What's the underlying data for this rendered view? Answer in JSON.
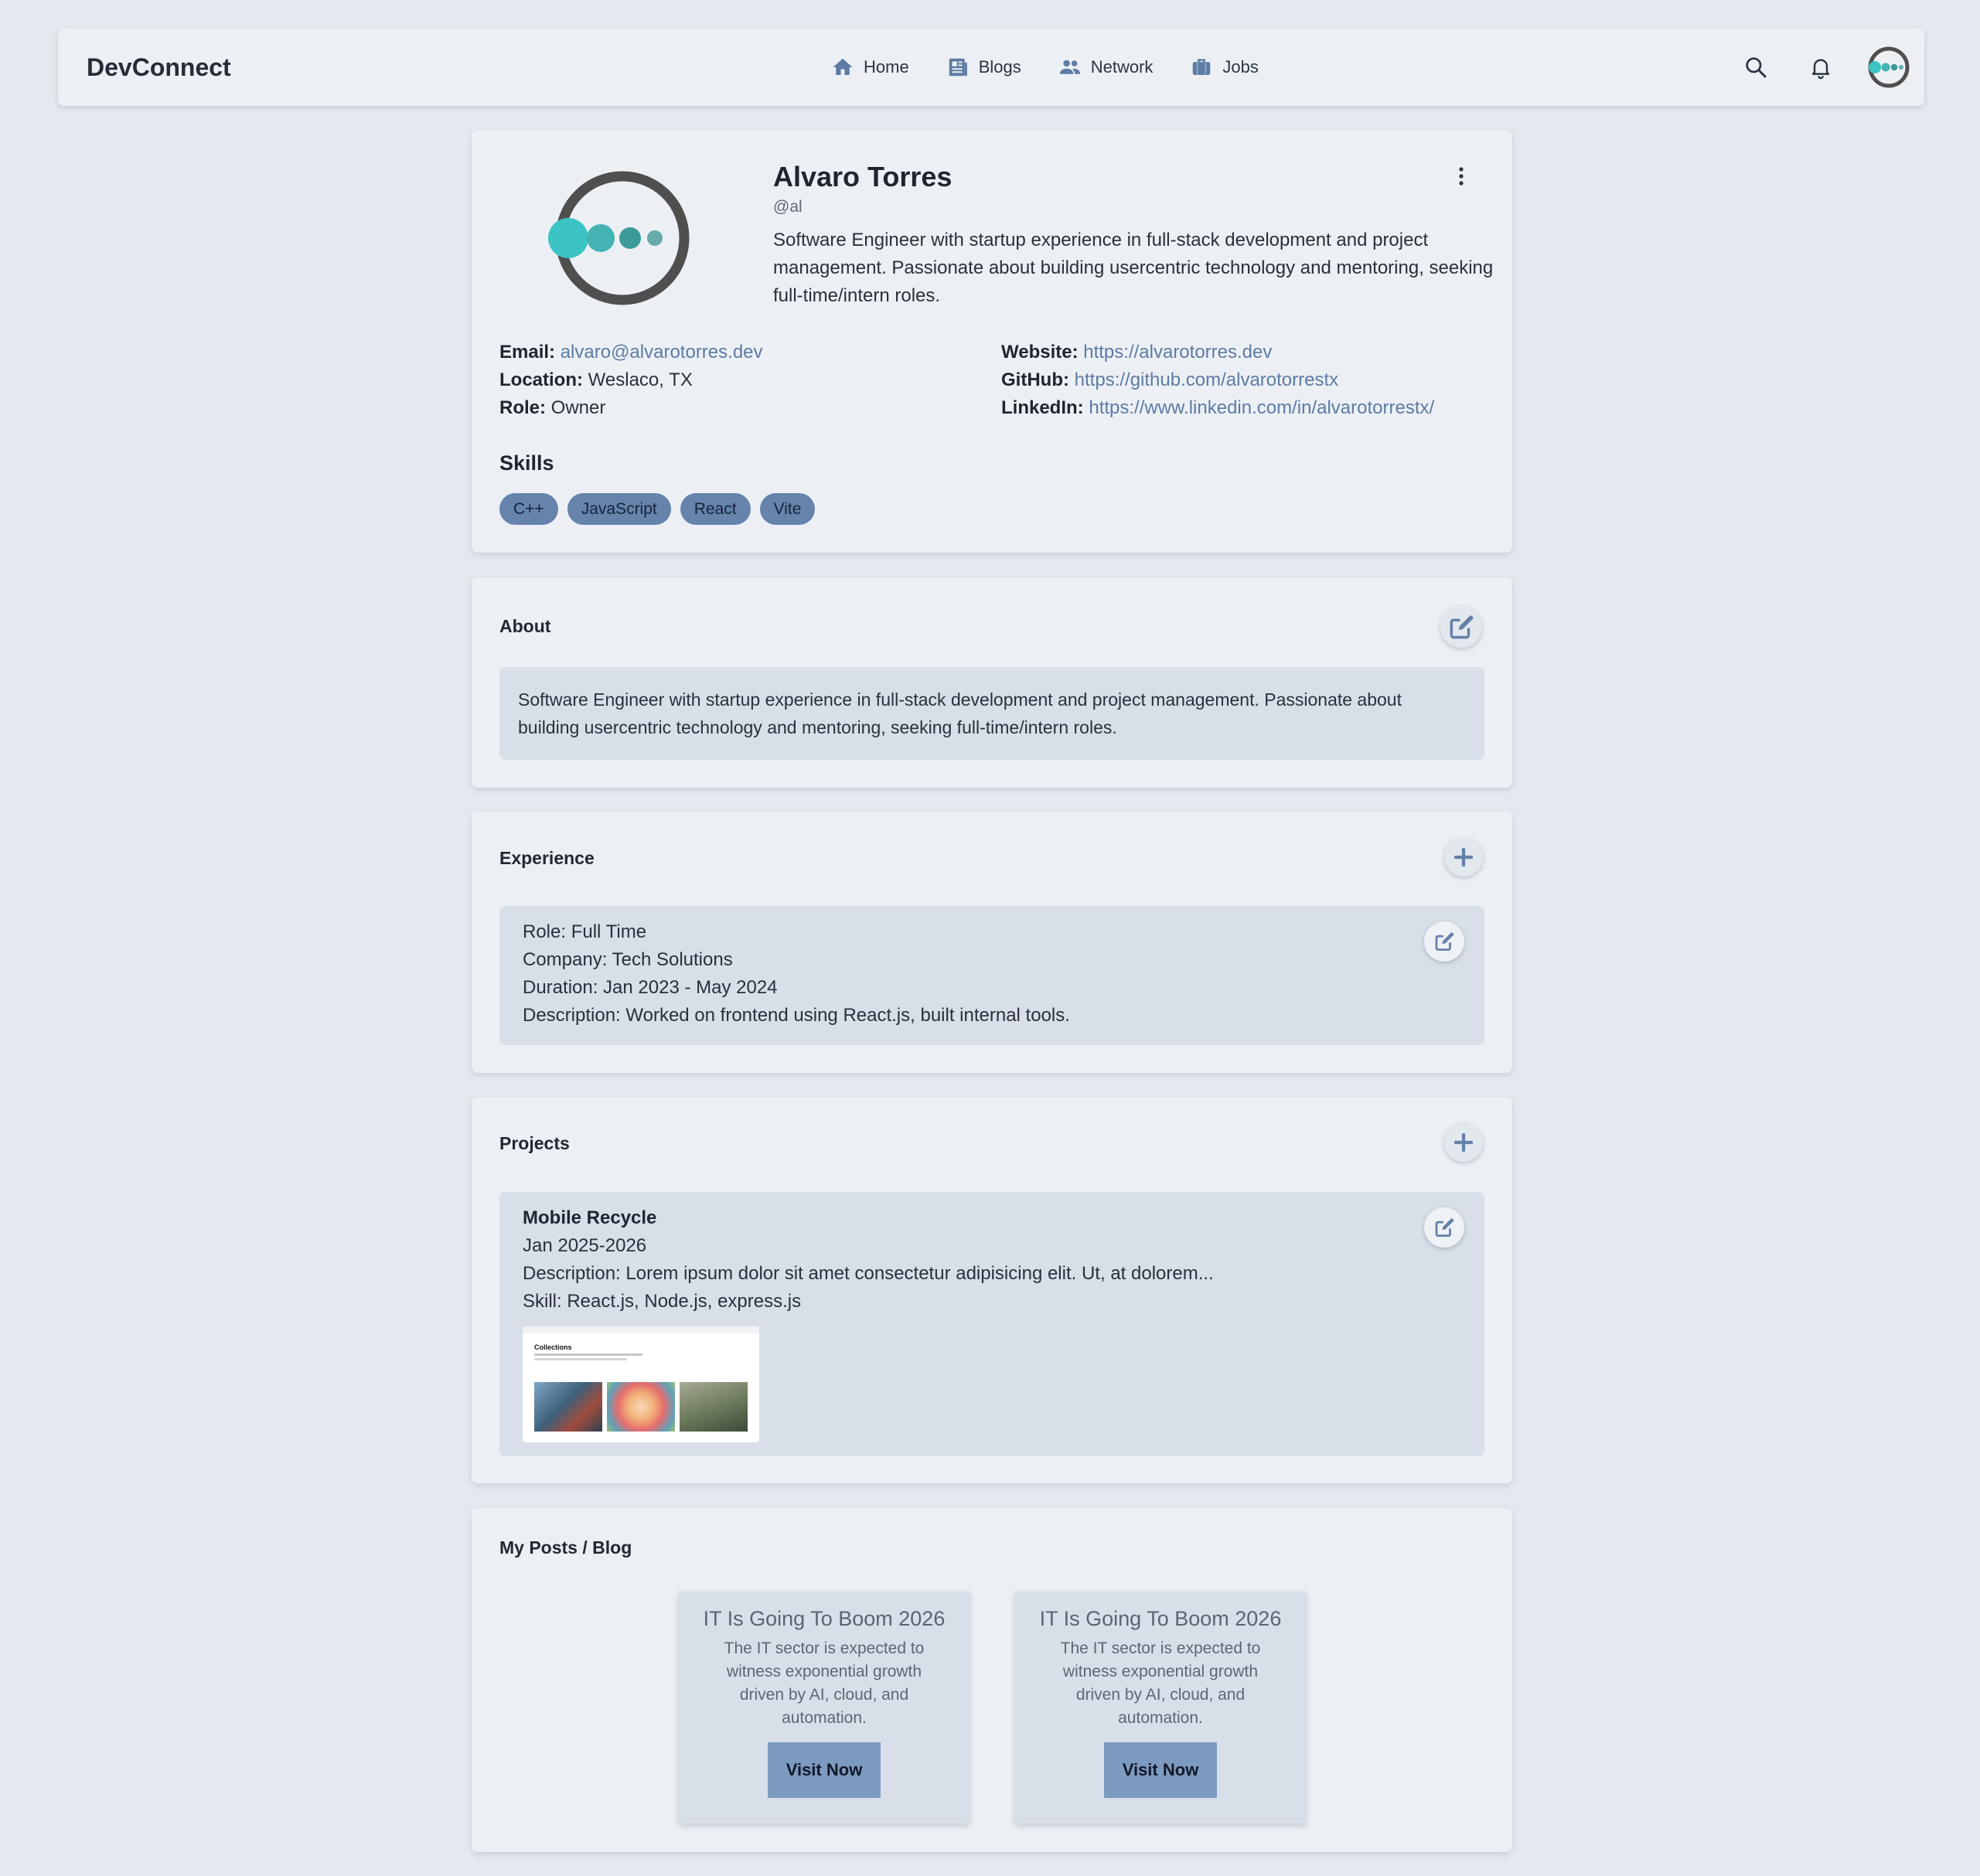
{
  "navbar": {
    "brand": "DevConnect",
    "links": [
      {
        "label": "Home",
        "icon": "home-icon"
      },
      {
        "label": "Blogs",
        "icon": "newspaper-icon"
      },
      {
        "label": "Network",
        "icon": "people-icon"
      },
      {
        "label": "Jobs",
        "icon": "briefcase-icon"
      }
    ],
    "actions": [
      "search-icon",
      "bell-icon",
      "avatar"
    ]
  },
  "colors": {
    "background": "#e4e9f0",
    "card": "#ecf0f5",
    "inner_box": "#d8dfe8",
    "accent": "#5d7ba3",
    "skill_chip": "#6683ac",
    "button": "#7d9ac0",
    "logo_teal": "#3cc3c3",
    "logo_ring": "#4f4f4f"
  },
  "profile": {
    "name": "Alvaro Torres",
    "handle": "@al",
    "bio": "Software Engineer with startup experience in full-stack development and project management. Passionate about building usercentric technology and mentoring, seeking full-time/intern roles.",
    "email_label": "Email:",
    "email": "alvaro@alvarotorres.dev",
    "location_label": "Location:",
    "location": "Weslaco, TX",
    "role_label": "Role:",
    "role": "Owner",
    "website_label": "Website:",
    "website": "https://alvarotorres.dev",
    "github_label": "GitHub:",
    "github": "https://github.com/alvarotorrestx",
    "linkedin_label": "LinkedIn:",
    "linkedin": "https://www.linkedin.com/in/alvarotorrestx/",
    "skills_title": "Skills",
    "skills": [
      "C++",
      "JavaScript",
      "React",
      "Vite"
    ]
  },
  "about": {
    "title": "About",
    "text": "Software Engineer with startup experience in full-stack development and project management. Passionate about building usercentric technology and mentoring, seeking full-time/intern roles."
  },
  "experience": {
    "title": "Experience",
    "items": [
      {
        "role": "Role: Full Time",
        "company": "Company: Tech Solutions",
        "duration": "Duration: Jan 2023 - May 2024",
        "description": "Description: Worked on frontend using React.js, built internal tools."
      }
    ]
  },
  "projects": {
    "title": "Projects",
    "items": [
      {
        "name": "Mobile Recycle",
        "date": "Jan 2025-2026",
        "description": "Description: Lorem ipsum dolor sit amet consectetur adipisicing elit. Ut, at dolorem...",
        "skills": "Skill: React.js, Node.js, express.js",
        "thumbnail_heading": "Collections"
      }
    ]
  },
  "posts": {
    "title": "My Posts / Blog",
    "items": [
      {
        "title": "IT Is Going To Boom 2026",
        "description": "The IT sector is expected to witness exponential growth driven by AI, cloud, and automation.",
        "button": "Visit Now"
      },
      {
        "title": "IT Is Going To Boom 2026",
        "description": "The IT sector is expected to witness exponential growth driven by AI, cloud, and automation.",
        "button": "Visit Now"
      }
    ]
  }
}
